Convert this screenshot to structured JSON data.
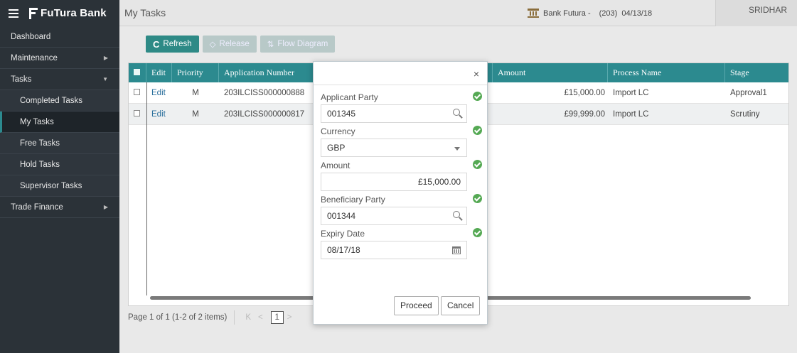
{
  "header": {
    "brand": "FuTura Bank",
    "page_title": "My Tasks",
    "bank_info": "Bank Futura -",
    "branch": "(203)",
    "date": "04/13/18",
    "user": "SRIDHAR"
  },
  "sidebar": {
    "items": [
      {
        "label": "Dashboard"
      },
      {
        "label": "Maintenance"
      },
      {
        "label": "Tasks"
      },
      {
        "label": "Completed Tasks"
      },
      {
        "label": "My Tasks"
      },
      {
        "label": "Free Tasks"
      },
      {
        "label": "Hold Tasks"
      },
      {
        "label": "Supervisor Tasks"
      },
      {
        "label": "Trade Finance"
      }
    ]
  },
  "toolbar": {
    "refresh": "Refresh",
    "release": "Release",
    "flow_diagram": "Flow Diagram"
  },
  "grid": {
    "columns": [
      "Edit",
      "Priority",
      "Application Number",
      "Amount",
      "Process Name",
      "Stage"
    ],
    "rows": [
      {
        "edit": "Edit",
        "priority": "M",
        "app_no": "203ILCISS000000888",
        "amount": "£15,000.00",
        "process": "Import LC",
        "stage": "Approval1"
      },
      {
        "edit": "Edit",
        "priority": "M",
        "app_no": "203ILCISS000000817",
        "amount": "£99,999.00",
        "process": "Import LC",
        "stage": "Scrutiny"
      }
    ]
  },
  "pager": {
    "text": "Page  1  of 1  (1-2 of 2 items)",
    "first": "K",
    "prev": "<",
    "current": "1",
    "next": ">"
  },
  "modal": {
    "applicant_party_label": "Applicant Party",
    "applicant_party_value": "001345",
    "currency_label": "Currency",
    "currency_value": "GBP",
    "amount_label": "Amount",
    "amount_value": "£15,000.00",
    "beneficiary_label": "Beneficiary Party",
    "beneficiary_value": "001344",
    "expiry_label": "Expiry Date",
    "expiry_value": "08/17/18",
    "proceed": "Proceed",
    "cancel": "Cancel",
    "close": "×"
  },
  "colors": {
    "sidebar_bg": "#2b3238",
    "accent": "#2c8a8f",
    "check": "#55a954"
  }
}
